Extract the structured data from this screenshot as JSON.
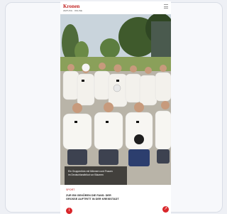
{
  "header": {
    "logo_text": "Kronen",
    "logo_sub": "ZEITUNG · ONLINE"
  },
  "hero": {
    "caption_lines": [
      "Ein Gruppenfoto mit Männern und Frauen",
      "im Deutschlandtrikot vor Bäumen"
    ]
  },
  "article": {
    "category": "Sport",
    "headline_lines": [
      "ZUR EM GEHÖREN DIE FANS: DER",
      "GROSSE AUFTRITT IN DER KREISSTADT"
    ]
  },
  "icons": {
    "menu": "hamburger-menu-icon",
    "left_fab": "info-icon",
    "right_fab": "share-icon"
  },
  "colors": {
    "accent": "#d9262a",
    "jersey": "#ffffff",
    "sky": "#c9d4dc"
  }
}
